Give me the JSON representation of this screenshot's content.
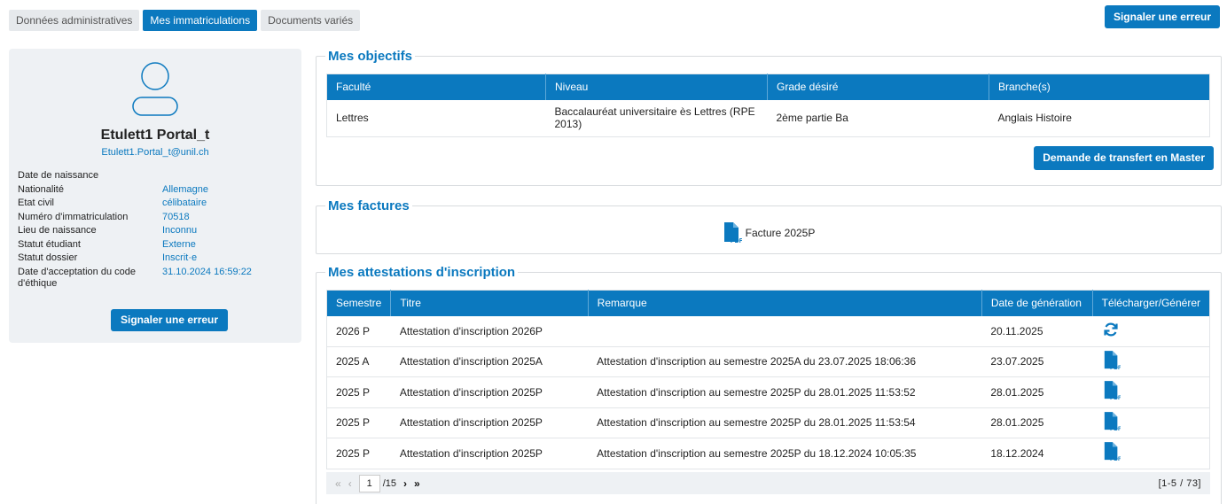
{
  "tabs": [
    {
      "label": "Données administratives",
      "active": false
    },
    {
      "label": "Mes immatriculations",
      "active": true
    },
    {
      "label": "Documents variés",
      "active": false
    }
  ],
  "top_button": "Signaler une erreur",
  "profile": {
    "name": "Etulett1 Portal_t",
    "email": "Etulett1.Portal_t@unil.ch",
    "fields": [
      {
        "label": "Date de naissance",
        "value": ""
      },
      {
        "label": "Nationalité",
        "value": "Allemagne"
      },
      {
        "label": "Etat civil",
        "value": "célibataire"
      },
      {
        "label": "Numéro d'immatriculation",
        "value": "70518"
      },
      {
        "label": "Lieu de naissance",
        "value": "Inconnu"
      },
      {
        "label": "Statut étudiant",
        "value": "Externe"
      },
      {
        "label": "Statut dossier",
        "value": "Inscrit·e"
      },
      {
        "label": "Date d'acceptation du code d'éthique",
        "value": "31.10.2024 16:59:22"
      }
    ],
    "button": "Signaler une erreur"
  },
  "objectifs": {
    "title": "Mes objectifs",
    "headers": [
      "Faculté",
      "Niveau",
      "Grade désiré",
      "Branche(s)"
    ],
    "rows": [
      [
        "Lettres",
        "Baccalauréat universitaire ès Lettres (RPE 2013)",
        "2ème partie Ba",
        "Anglais Histoire"
      ]
    ],
    "button": "Demande de transfert en Master"
  },
  "factures": {
    "title": "Mes factures",
    "item": "Facture 2025P"
  },
  "attestations": {
    "title": "Mes attestations d'inscription",
    "headers": [
      "Semestre",
      "Titre",
      "Remarque",
      "Date de génération",
      "Télécharger/Générer"
    ],
    "rows": [
      {
        "semestre": "2026 P",
        "titre": "Attestation d'inscription 2026P",
        "remarque": "",
        "date": "20.11.2025",
        "action": "refresh-icon"
      },
      {
        "semestre": "2025 A",
        "titre": "Attestation d'inscription 2025A",
        "remarque": "Attestation d'inscription au semestre 2025A du 23.07.2025 18:06:36",
        "date": "23.07.2025",
        "action": "pdf-icon"
      },
      {
        "semestre": "2025 P",
        "titre": "Attestation d'inscription 2025P",
        "remarque": "Attestation d'inscription au semestre 2025P du 28.01.2025 11:53:52",
        "date": "28.01.2025",
        "action": "pdf-icon"
      },
      {
        "semestre": "2025 P",
        "titre": "Attestation d'inscription 2025P",
        "remarque": "Attestation d'inscription au semestre 2025P du 28.01.2025 11:53:54",
        "date": "28.01.2025",
        "action": "pdf-icon"
      },
      {
        "semestre": "2025 P",
        "titre": "Attestation d'inscription 2025P",
        "remarque": "Attestation d'inscription au semestre 2025P du 18.12.2024 10:05:35",
        "date": "18.12.2024",
        "action": "pdf-icon"
      }
    ],
    "pager": {
      "page": "1",
      "total": "/15",
      "count": "[1-5 / 73]"
    }
  },
  "colors": {
    "accent": "#0b79bf",
    "panel": "#eef1f4"
  }
}
